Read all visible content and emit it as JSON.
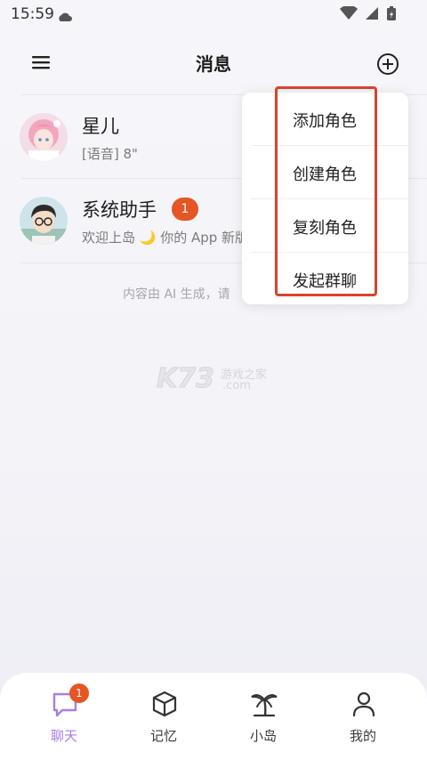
{
  "status_bar": {
    "time": "15:59"
  },
  "header": {
    "title": "消息"
  },
  "chats": [
    {
      "name": "星儿",
      "preview": "[语音] 8\""
    },
    {
      "name": "系统助手",
      "preview": "欢迎上岛 🌙 你的 App 新版",
      "unread": "1"
    }
  ],
  "footer_note": "内容由 AI 生成，请",
  "dropdown": {
    "items": [
      "添加角色",
      "创建角色",
      "复刻角色",
      "发起群聊"
    ]
  },
  "watermark": {
    "logo": "K73",
    "text_cn": "游戏之家",
    "text_en": ".com"
  },
  "bottom_nav": [
    {
      "label": "聊天",
      "badge": "1",
      "active": true
    },
    {
      "label": "记忆"
    },
    {
      "label": "小岛"
    },
    {
      "label": "我的"
    }
  ],
  "colors": {
    "accent": "#a97ee0",
    "badge": "#e65524",
    "highlight": "#d8432c"
  }
}
